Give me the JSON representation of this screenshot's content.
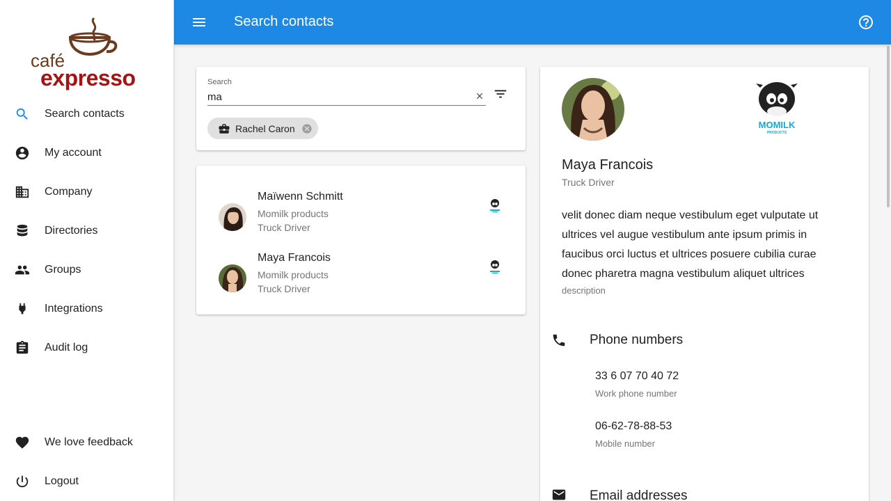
{
  "sidebar": {
    "logo": {
      "line1": "café",
      "line2": "expresso"
    },
    "items": [
      {
        "label": "Search contacts",
        "icon": "search-icon",
        "active": true
      },
      {
        "label": "My account",
        "icon": "account-circle-icon"
      },
      {
        "label": "Company",
        "icon": "business-icon"
      },
      {
        "label": "Directories",
        "icon": "database-icon"
      },
      {
        "label": "Groups",
        "icon": "people-icon"
      },
      {
        "label": "Integrations",
        "icon": "plug-icon"
      },
      {
        "label": "Audit log",
        "icon": "clipboard-icon"
      }
    ],
    "bottom_items": [
      {
        "label": "We love feedback",
        "icon": "heart-icon"
      },
      {
        "label": "Logout",
        "icon": "power-icon"
      }
    ]
  },
  "appbar": {
    "title": "Search contacts",
    "accent": "#1e88e5"
  },
  "search": {
    "label": "Search",
    "value": "ma",
    "chip": {
      "label": "Rachel Caron",
      "icon": "briefcase-icon"
    }
  },
  "results": [
    {
      "name": "Maïwenn Schmitt",
      "company": "Momilk products",
      "job": "Truck Driver"
    },
    {
      "name": "Maya Francois",
      "company": "Momilk products",
      "job": "Truck Driver"
    }
  ],
  "detail": {
    "name": "Maya Francois",
    "job": "Truck Driver",
    "company_logo_text": "MOMILK",
    "company_logo_subtext": "PRODUCTS",
    "description": "velit donec diam neque vestibulum eget vulputate ut ultrices vel augue vestibulum ante ipsum primis in faucibus orci luctus et ultrices posuere cubilia curae donec pharetra magna vestibulum aliquet ultrices",
    "description_label": "description",
    "phone_section": {
      "title": "Phone numbers",
      "entries": [
        {
          "value": "33 6 07 70 40 72",
          "label": "Work phone number"
        },
        {
          "value": "06-62-78-88-53",
          "label": "Mobile number"
        }
      ]
    },
    "email_section": {
      "title": "Email addresses"
    }
  }
}
